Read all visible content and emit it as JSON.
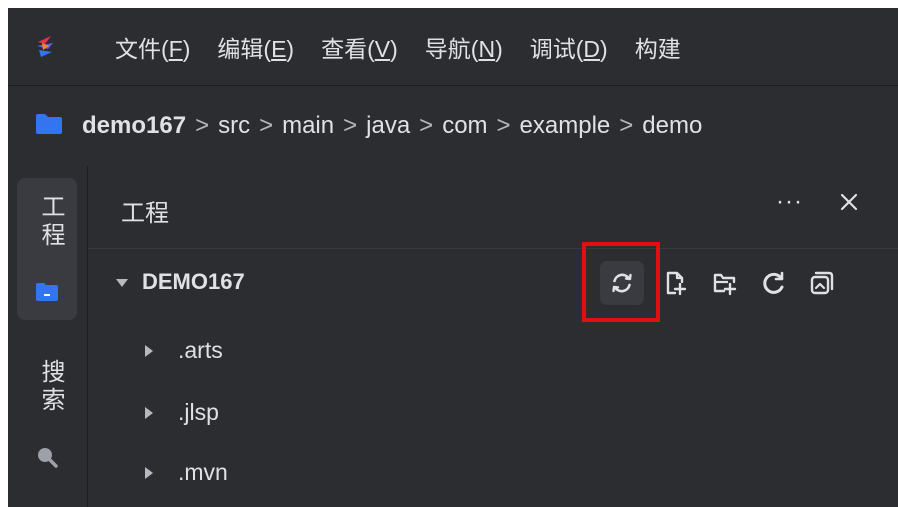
{
  "menu": {
    "items": [
      {
        "label": "文件(",
        "mnemonic": "F",
        "tail": ")"
      },
      {
        "label": "编辑(",
        "mnemonic": "E",
        "tail": ")"
      },
      {
        "label": "查看(",
        "mnemonic": "V",
        "tail": ")"
      },
      {
        "label": "导航(",
        "mnemonic": "N",
        "tail": ")"
      },
      {
        "label": "调试(",
        "mnemonic": "D",
        "tail": ")"
      },
      {
        "label": "构建",
        "mnemonic": "",
        "tail": ""
      }
    ]
  },
  "breadcrumb": {
    "root": "demo167",
    "separator": ">",
    "segments": [
      "src",
      "main",
      "java",
      "com",
      "example",
      "demo"
    ]
  },
  "toolstrip": {
    "project_label": "工程",
    "search_label": "搜索"
  },
  "panel": {
    "title": "工程",
    "more_label": "···",
    "root_label": "DEMO167",
    "items": [
      ".arts",
      ".jlsp",
      ".mvn"
    ]
  },
  "colors": {
    "background": "#1e1f22",
    "panel": "#2b2d30",
    "text": "#dfe1e5",
    "folder_blue": "#3574f0",
    "highlight_red": "#e10f10"
  }
}
